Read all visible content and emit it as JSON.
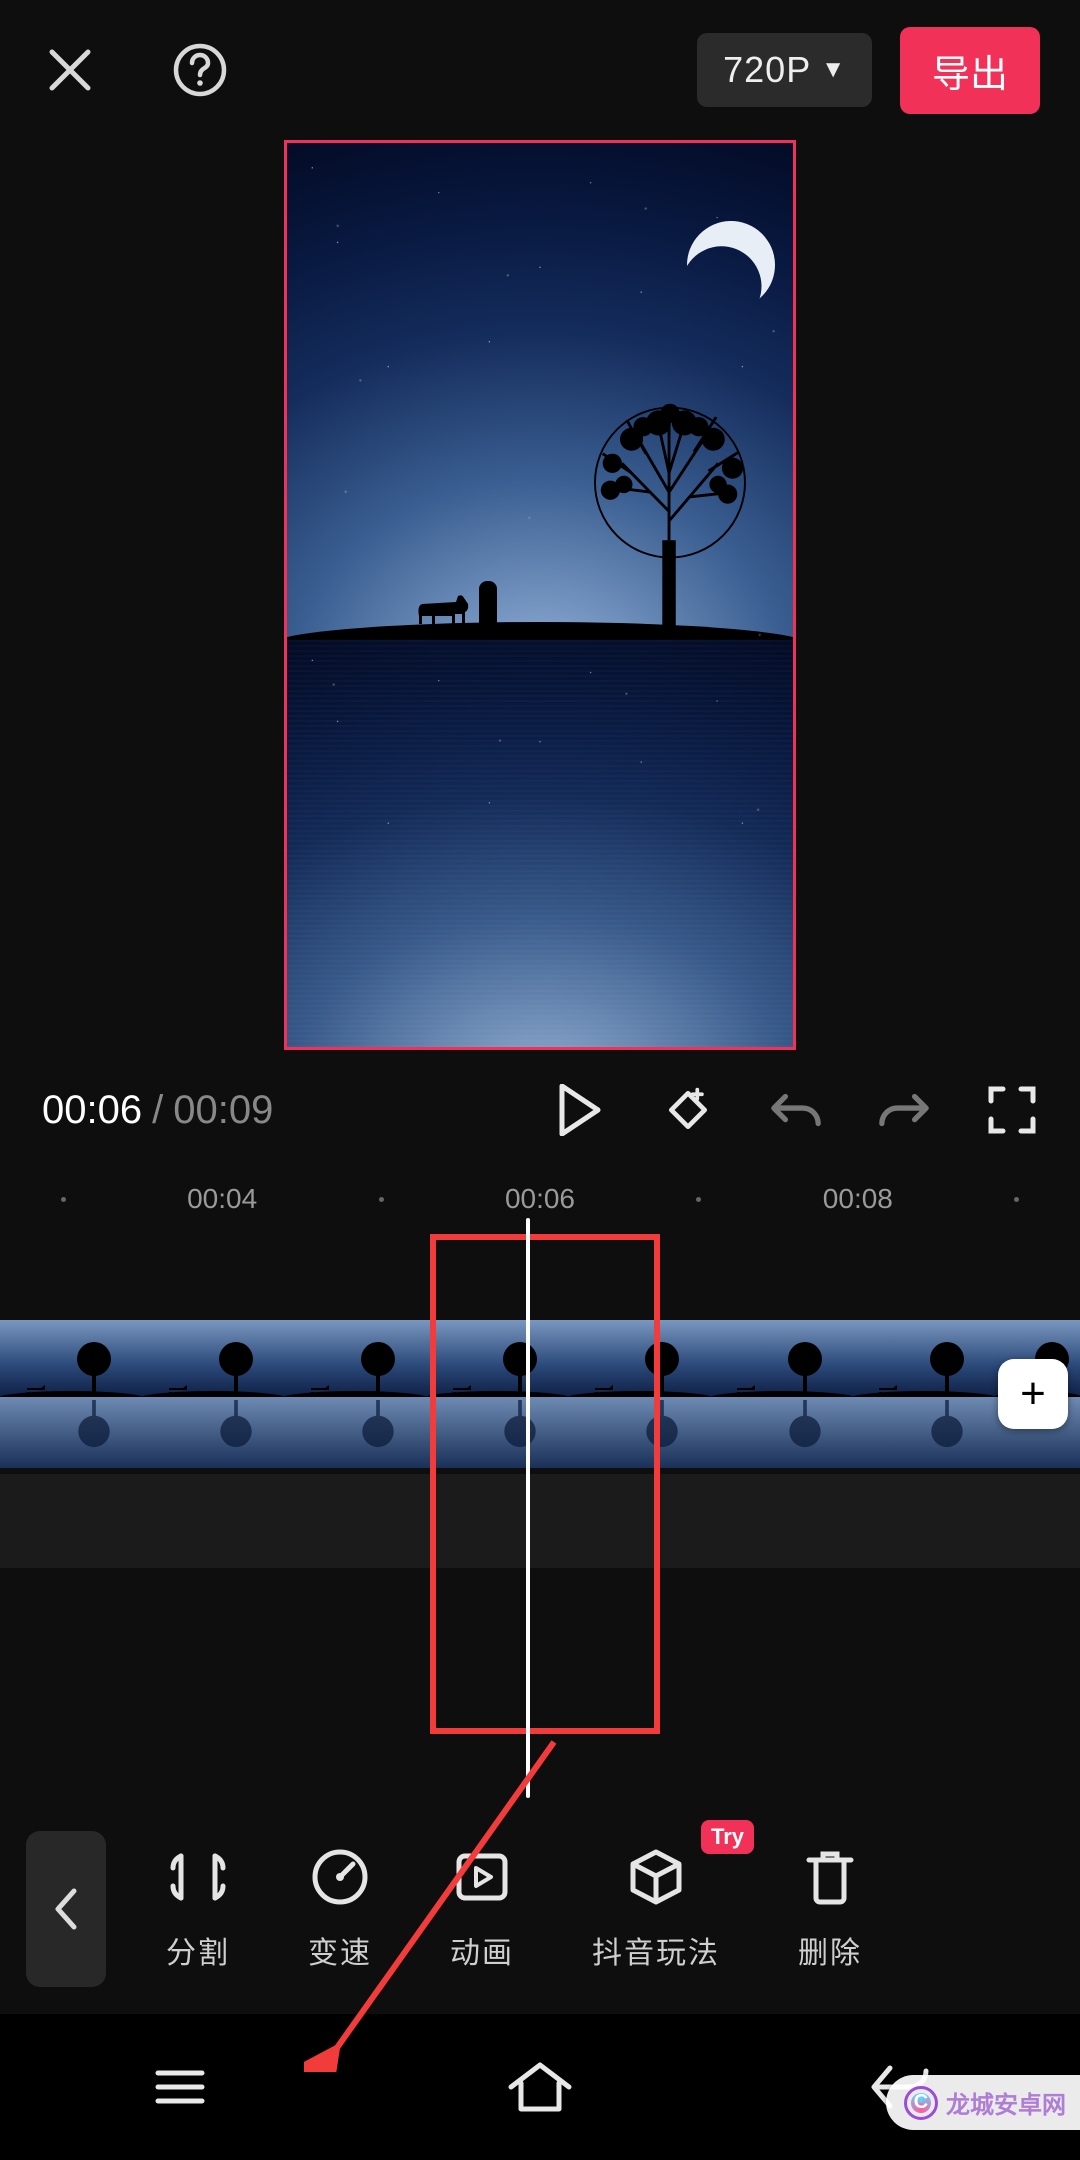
{
  "header": {
    "resolution": "720P",
    "export_label": "导出"
  },
  "playback": {
    "current_time": "00:06",
    "separator": "/",
    "duration": "00:09"
  },
  "ruler": {
    "marks": [
      "00:04",
      "00:06",
      "00:08"
    ]
  },
  "tools": {
    "split": "分割",
    "speed": "变速",
    "animation": "动画",
    "douyin": "抖音玩法",
    "delete": "删除",
    "try_badge": "Try"
  },
  "add_clip": "+",
  "watermark": "龙城安卓网"
}
